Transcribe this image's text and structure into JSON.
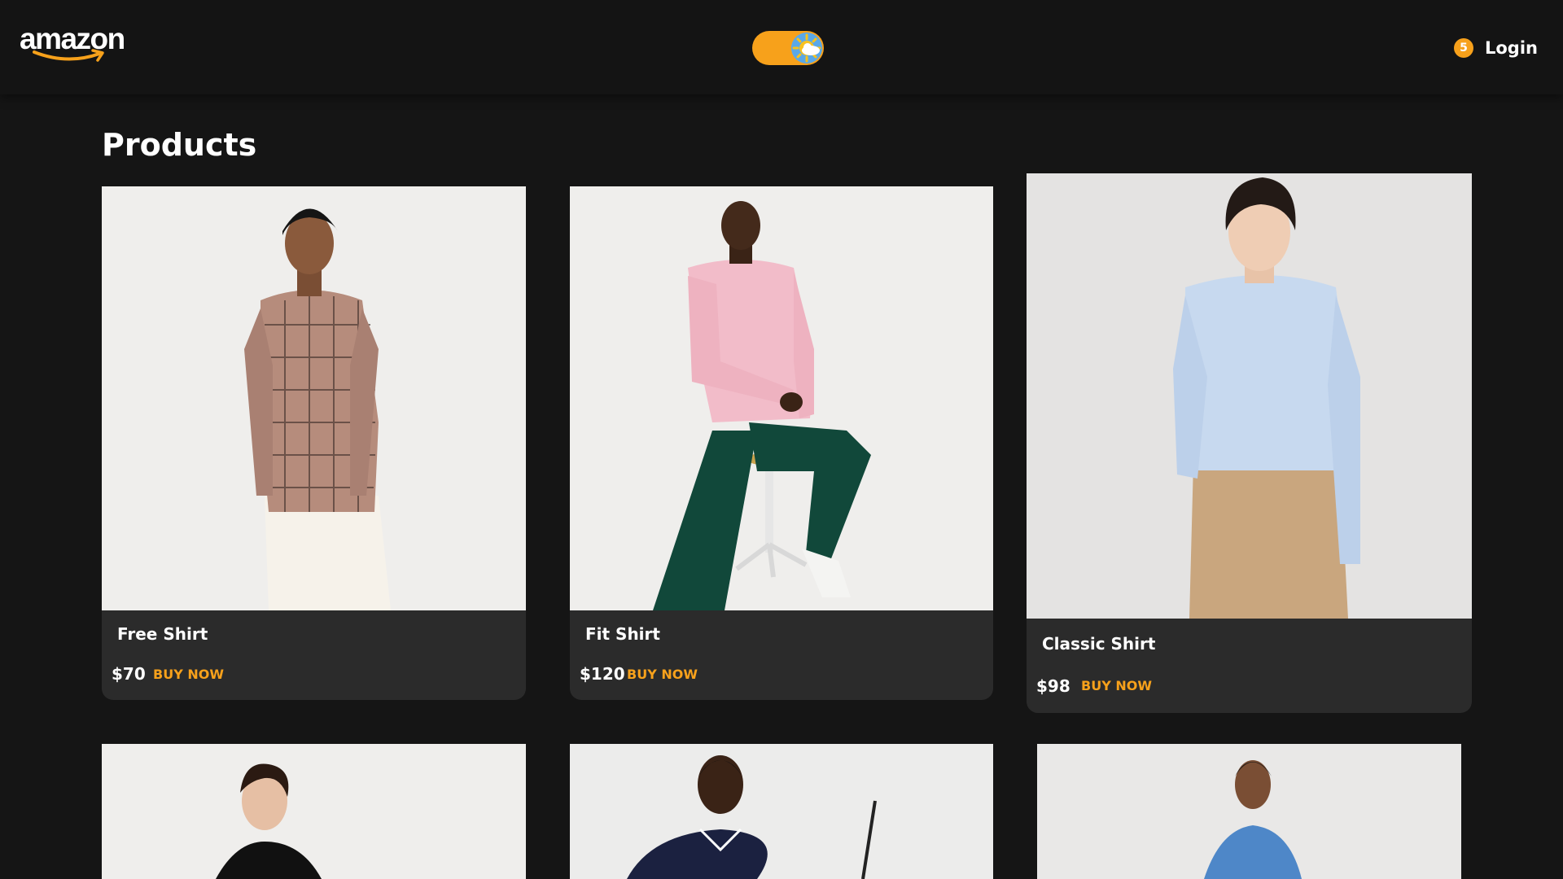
{
  "header": {
    "logo_text": "amazon",
    "theme_toggle": {
      "state": "light",
      "icon": "sun-cloud-icon"
    },
    "cart_count": "5",
    "login_label": "Login"
  },
  "main": {
    "title": "Products",
    "products": [
      {
        "name": "Free Shirt",
        "price": "$70",
        "action": "BUY NOW"
      },
      {
        "name": "Fit Shirt",
        "price": "$120",
        "action": "BUY NOW"
      },
      {
        "name": "Classic Shirt",
        "price": "$98",
        "action": "BUY NOW"
      }
    ]
  },
  "colors": {
    "background": "#151515",
    "card": "#2b2b2b",
    "accent": "#f7a11b"
  }
}
